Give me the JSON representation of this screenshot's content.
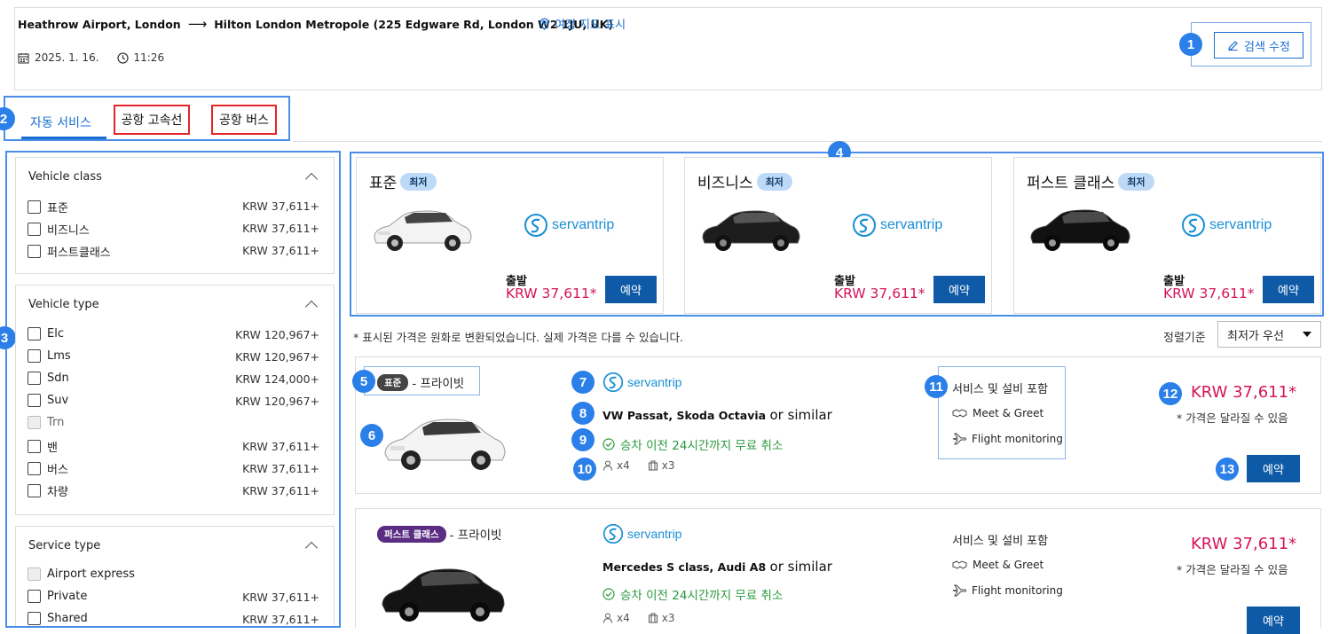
{
  "trip": {
    "origin": "Heathrow Airport, London",
    "arrow": "⟶",
    "destination": "Hilton London Metropole (225 Edgware Rd, London W2 1JU, UK)",
    "map_link": "여정 지도 표시",
    "date": "2025. 1. 16.",
    "time": "11:26",
    "edit_button": "검색 수정"
  },
  "markers": [
    "1",
    "2",
    "3",
    "4",
    "5",
    "6",
    "7",
    "8",
    "9",
    "10",
    "11",
    "12",
    "13"
  ],
  "tabs": [
    {
      "label": "자동 서비스",
      "active": true
    },
    {
      "label": "공항 고속선",
      "active": false
    },
    {
      "label": "공항 버스",
      "active": false
    }
  ],
  "filters": [
    {
      "title": "Vehicle class",
      "items": [
        {
          "label": "표준",
          "price": "KRW 37,611+",
          "disabled": false
        },
        {
          "label": "비즈니스",
          "price": "KRW 37,611+",
          "disabled": false
        },
        {
          "label": "퍼스트클래스",
          "price": "KRW 37,611+",
          "disabled": false
        }
      ]
    },
    {
      "title": "Vehicle type",
      "items": [
        {
          "label": "Elc",
          "price": "KRW 120,967+",
          "disabled": false
        },
        {
          "label": "Lms",
          "price": "KRW 120,967+",
          "disabled": false
        },
        {
          "label": "Sdn",
          "price": "KRW 124,000+",
          "disabled": false
        },
        {
          "label": "Suv",
          "price": "KRW 120,967+",
          "disabled": false
        },
        {
          "label": "Trn",
          "price": "",
          "disabled": true
        },
        {
          "label": "밴",
          "price": "KRW 37,611+",
          "disabled": false
        },
        {
          "label": "버스",
          "price": "KRW 37,611+",
          "disabled": false
        },
        {
          "label": "차량",
          "price": "KRW 37,611+",
          "disabled": false
        }
      ]
    },
    {
      "title": "Service type",
      "items": [
        {
          "label": "Airport express",
          "price": "",
          "disabled": true
        },
        {
          "label": "Private",
          "price": "KRW 37,611+",
          "disabled": false
        },
        {
          "label": "Shared",
          "price": "KRW 37,611+",
          "disabled": false
        }
      ]
    }
  ],
  "class_cards": [
    {
      "title": "표준",
      "badge": "최저",
      "brand": "servantrip",
      "depart": "출발",
      "price": "KRW 37,611*",
      "book": "예약"
    },
    {
      "title": "비즈니스",
      "badge": "최저",
      "brand": "servantrip",
      "depart": "출발",
      "price": "KRW 37,611*",
      "book": "예약"
    },
    {
      "title": "퍼스트 클래스",
      "badge": "최저",
      "brand": "servantrip",
      "depart": "출발",
      "price": "KRW 37,611*",
      "book": "예약"
    }
  ],
  "notice": "* 표시된 가격은 원화로 변환되었습니다. 실제 가격은 다를 수 있습니다.",
  "sort": {
    "label": "정렬기준",
    "value": "최저가 우선"
  },
  "results": [
    {
      "badge": "표준",
      "badge_color": "#444444",
      "type": "- 프라이빗",
      "brand": "servantrip",
      "model": "VW Passat, Skoda Octavia",
      "similar": "or similar",
      "cancel": "승차 이전 24시간까지 무료 취소",
      "pax": "x4",
      "bags": "x3",
      "services_title": "서비스 및 설비 포함",
      "service_1": "Meet & Greet",
      "service_2": "Flight monitoring",
      "price": "KRW 37,611*",
      "price_note": "* 가격은 달라질 수 있음",
      "book": "예약",
      "car_color": "#f4f4f4"
    },
    {
      "badge": "퍼스트 클래스",
      "badge_color": "#5a2d82",
      "type": "- 프라이빗",
      "brand": "servantrip",
      "model": "Mercedes S class, Audi A8",
      "similar": "or similar",
      "cancel": "승차 이전 24시간까지 무료 취소",
      "pax": "x4",
      "bags": "x3",
      "services_title": "서비스 및 설비 포함",
      "service_1": "Meet & Greet",
      "service_2": "Flight monitoring",
      "price": "KRW 37,611*",
      "price_note": "* 가격은 달라질 수 있음",
      "book": "예약",
      "car_color": "#1a1a1a"
    }
  ],
  "colors": {
    "accent": "#1a6fd1",
    "price": "#d4145a",
    "book_button": "#0e5aa7",
    "marker": "#2a7fe8",
    "highlight_frame": "#4a8ee8",
    "red_box": "#e2262a"
  }
}
